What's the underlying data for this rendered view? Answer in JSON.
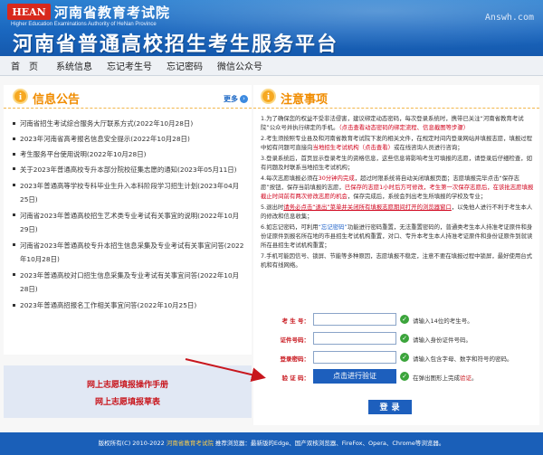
{
  "header": {
    "logo_text": "HEAN",
    "org_name": "河南省教育考试院",
    "org_name_en": "Higher Education Examinations Authority of HeNan Province",
    "site_title": "河南省普通高校招生考生服务平台",
    "watermark": "Answh.com"
  },
  "nav": {
    "items": [
      "首页",
      "系统信息",
      "忘记考生号",
      "忘记密码",
      "微信公众号"
    ]
  },
  "news_panel": {
    "title": "信息公告",
    "more_label": "更多",
    "items": [
      "河南省招生考试综合服务大厅联系方式(2022年10月28日)",
      "2023年河南省高考报名信息安全提示(2022年10月28日)",
      "考生服务平台使用说明(2022年10月28日)",
      "关于2023年普通高校专升本部分院校征集志愿的通知(2023年05月11日)",
      "2023年普通高等学校专科毕业生升入本科阶段学习招生计划(2023年04月25日)",
      "河南省2023年普通高校招生艺术类专业考试有关事宜的说明(2022年10月29日)",
      "河南省2023年普通高校专升本招生信息采集及专业考试有关事宜问答(2022年10月28日)",
      "2023年普通高校对口招生信息采集及专业考试有关事宜问答(2022年10月28日)",
      "2023年普通高招报名工作相关事宜问答(2022年10月25日)"
    ]
  },
  "guides": {
    "manual": "网上志愿填报操作手册",
    "form": "网上志愿填报草表"
  },
  "notice_panel": {
    "title": "注意事项",
    "items": [
      {
        "num": "1.",
        "parts": [
          {
            "t": "为了确保您的权益不受非法侵害，建议绑定动态密码，每次登录系统时，携带已关注“河南省教育考试院”公众号并执行绑定的手机。",
            "c": ""
          },
          {
            "t": "（点击查看动态密码的绑定流程、信息截图等步骤）",
            "c": "hl"
          }
        ]
      },
      {
        "num": "2.",
        "parts": [
          {
            "t": "考生须按照专业县及和河南省教育考试院下发的相关文件，在规定时间内登录网站并填报志愿，填报过程中如有问题可直接向",
            "c": ""
          },
          {
            "t": "当地招生考试机构（点击查看）",
            "c": "hl"
          },
          {
            "t": "或在线咨询人员进行咨询；",
            "c": ""
          }
        ]
      },
      {
        "num": "3.",
        "parts": [
          {
            "t": "登录系统后，首页显示登录考生的资格信息，这些信息将影响考生可填报的志愿，请登录后仔细检查，如有问题及时联系当地招生考试机构；",
            "c": ""
          }
        ]
      },
      {
        "num": "4.",
        "parts": [
          {
            "t": "每次志愿填报必须在",
            "c": ""
          },
          {
            "t": "30分钟内完成",
            "c": "hl"
          },
          {
            "t": "，超过时限系统将自动关闭填报页面；志愿填报完毕点击“保存志愿”按钮，保存当前填报的志愿，",
            "c": ""
          },
          {
            "t": "已保存的志愿1小时后方可修改，考生第一次保存志愿后，在该批志愿填报截止时间前有两次修改志愿的机会",
            "c": "hl"
          },
          {
            "t": "，保存完成后，系统会列出考生所填报的学校及专业；",
            "c": ""
          }
        ]
      },
      {
        "num": "5.",
        "parts": [
          {
            "t": "退出时",
            "c": ""
          },
          {
            "t": "请务必点击“退出”菜单并关闭所有填报志愿期间打开的浏览器窗口",
            "c": "hlb"
          },
          {
            "t": "，以免他人进行不利于考生本人的修改和信息收集；",
            "c": ""
          }
        ]
      },
      {
        "num": "6.",
        "parts": [
          {
            "t": "如忘记密码，可利用",
            "c": ""
          },
          {
            "t": "“忘记密码”",
            "c": "link"
          },
          {
            "t": "功能进行密码重置，无法重置密码的，普通类考生本人持准考证原件和身份证原件到报名所在地的市县招生考试机构重置，对口、专升本考生本人持准考证原件和身份证原件到就读所在县招生考试机构重置；",
            "c": ""
          }
        ]
      },
      {
        "num": "7.",
        "parts": [
          {
            "t": "手机可能因信号、锁屏、节能等多种原因，志愿填报不稳定，注意不要在填报过程中锁屏，最好使用台式机和有线网络。",
            "c": ""
          }
        ]
      }
    ]
  },
  "login_form": {
    "student_no_label": "考 生 号：",
    "student_no_value": "",
    "student_no_hint": "请输入14位的考生号。",
    "id_label": "证件号码：",
    "id_value": "",
    "id_hint": "请输入身份证件号码。",
    "password_label": "登录密码：",
    "password_value": "",
    "password_hint": "请输入包含字母、数字和符号的密码。",
    "verify_label": "验 证 码：",
    "verify_button": "点击进行验证",
    "verify_hint_prefix": "在弹出图形上完成",
    "verify_hint_action": "验证",
    "verify_hint_suffix": "。",
    "login_button": "登录"
  },
  "footer": {
    "copyright": "版权所有(C) 2010-2022",
    "org": "河南省教育考试院",
    "browsers": "推荐浏览器：最新版的Edge、国产双核浏览器、FireFox、Opera、Chrome等浏览器。"
  }
}
